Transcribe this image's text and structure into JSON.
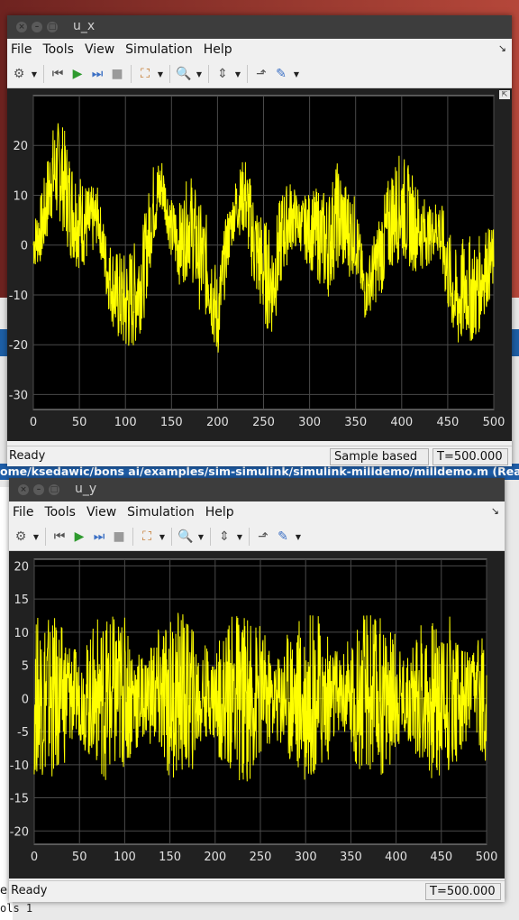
{
  "background": {
    "path": "ome/ksedawic/bons ai/examples/sim-simulink/simulink-milldemo/milldemo.m (Read",
    "bottom_status": "e Ready",
    "bottom_line": "ols       1"
  },
  "windows": [
    {
      "title": "u_x",
      "menu": [
        "File",
        "Tools",
        "View",
        "Simulation",
        "Help"
      ],
      "status": {
        "ready": "Ready",
        "sample": "Sample based",
        "time": "T=500.000"
      },
      "chart_data": {
        "type": "line",
        "x": [
          0,
          10,
          20,
          30,
          40,
          50,
          60,
          70,
          80,
          90,
          100,
          110,
          120,
          130,
          140,
          150,
          160,
          170,
          180,
          190,
          200,
          210,
          220,
          230,
          240,
          250,
          260,
          270,
          280,
          290,
          300,
          310,
          320,
          330,
          340,
          350,
          360,
          370,
          380,
          390,
          400,
          410,
          420,
          430,
          440,
          450,
          460,
          470,
          480,
          490,
          500
        ],
        "series": [
          {
            "color": "#ffff00",
            "band": 6,
            "values": [
              0,
              4,
              14,
              15,
              8,
              5,
              4,
              6,
              -5,
              -10,
              -12,
              -10,
              -5,
              8,
              12,
              3,
              0,
              5,
              -2,
              -5,
              -15,
              0,
              8,
              10,
              0,
              -5,
              -8,
              2,
              6,
              4,
              3,
              2,
              0,
              6,
              3,
              2,
              -10,
              -5,
              0,
              6,
              8,
              5,
              3,
              2,
              4,
              -5,
              -12,
              -8,
              -10,
              -5,
              -3
            ]
          }
        ],
        "xlim": [
          0,
          500
        ],
        "ylim": [
          -33,
          30
        ],
        "xticks": [
          "0",
          "50",
          "100",
          "150",
          "200",
          "250",
          "300",
          "350",
          "400",
          "450",
          "500"
        ],
        "yticks": [
          "-30",
          "-20",
          "-10",
          "0",
          "10",
          "20"
        ],
        "grid": true,
        "xlabel": "",
        "ylabel": "",
        "title": ""
      }
    },
    {
      "title": "u_y",
      "menu": [
        "File",
        "Tools",
        "View",
        "Simulation",
        "Help"
      ],
      "status": {
        "ready": "",
        "sample": "",
        "time": "T=500.000"
      },
      "chart_data": {
        "type": "line",
        "x": [
          0,
          10,
          20,
          30,
          40,
          50,
          60,
          70,
          80,
          90,
          100,
          110,
          120,
          130,
          140,
          150,
          160,
          170,
          180,
          190,
          200,
          210,
          220,
          230,
          240,
          250,
          260,
          270,
          280,
          290,
          300,
          310,
          320,
          330,
          340,
          350,
          360,
          370,
          380,
          390,
          400,
          410,
          420,
          430,
          440,
          450,
          460,
          470,
          480,
          490,
          500
        ],
        "series": [
          {
            "color": "#ffff00",
            "band": 7,
            "values": [
              0,
              1,
              0,
              0,
              1,
              0,
              0,
              1,
              0,
              0,
              1,
              0,
              0,
              1,
              0,
              0,
              1,
              0,
              0,
              1,
              0,
              0,
              1,
              0,
              0,
              1,
              0,
              0,
              1,
              0,
              0,
              1,
              0,
              0,
              1,
              0,
              0,
              1,
              0,
              0,
              1,
              0,
              0,
              1,
              0,
              0,
              1,
              0,
              0,
              1,
              0
            ]
          }
        ],
        "xlim": [
          0,
          500
        ],
        "ylim": [
          -22,
          21
        ],
        "xticks": [
          "0",
          "50",
          "100",
          "150",
          "200",
          "250",
          "300",
          "350",
          "400",
          "450",
          "500"
        ],
        "yticks": [
          "-20",
          "-15",
          "-10",
          "-5",
          "0",
          "5",
          "10",
          "15",
          "20"
        ],
        "grid": true,
        "xlabel": "",
        "ylabel": "",
        "title": ""
      }
    }
  ]
}
